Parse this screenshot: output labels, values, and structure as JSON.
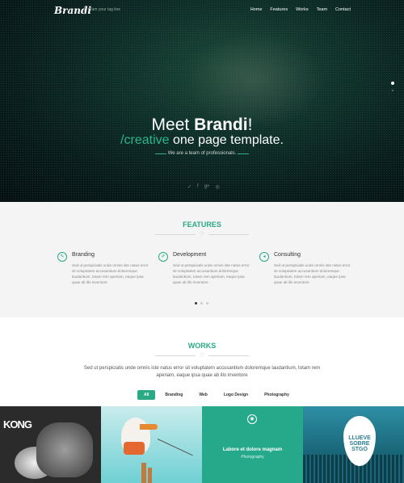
{
  "nav": {
    "logo": "Brandi",
    "tagline": "Tam your tag line",
    "menu": [
      "Home",
      "Features",
      "Works",
      "Team",
      "Contact"
    ]
  },
  "hero": {
    "title_pre": "Meet ",
    "title_bold": "Brandi",
    "title_post": "!",
    "sub_accent": "/creative",
    "sub_rest": " one page template.",
    "desc": "We are a team of professionals.",
    "social_icons": [
      "twitter-icon",
      "facebook-icon",
      "google-plus-icon",
      "dribbble-icon"
    ]
  },
  "features": {
    "title": "FEATURES",
    "items": [
      {
        "icon": "pen-icon",
        "title": "Branding",
        "text": "Sed ut perspiciatis unde omnis iste natus error sit voluptatem accusantium doloremque laudantium, totam rem aperiam, eaque ipsa quae ab illo inventore"
      },
      {
        "icon": "brush-icon",
        "title": "Development",
        "text": "Sed ut perspiciatis unde omnis iste natus error sit voluptatem accusantium doloremque laudantium, totam rem aperiam, eaque ipsa quae ab illo inventore"
      },
      {
        "icon": "megaphone-icon",
        "title": "Consulting",
        "text": "Sed ut perspiciatis unde omnis iste natus error sit voluptatem accusantium doloremque laudantium, totam rem aperiam, eaque ipsa quae ab illo inventore"
      }
    ]
  },
  "works": {
    "title": "WORKS",
    "desc": "Sed ut perspiciatis unde omnis iste natus error sit voluptatem accusantium doloremque laudantium, totam rem aperiam, eaque ipsa quae ab illo inventore",
    "filters": [
      "All",
      "Branding",
      "Web",
      "Logo Design",
      "Photography"
    ],
    "active_filter": "All",
    "grid": {
      "tile1_text": "KONG",
      "tile3_title": "Labore et dolore magnam",
      "tile3_sub": "Photography",
      "tile4_text": "LLUEVE SOBRE STGO"
    }
  },
  "colors": {
    "accent": "#2aa985",
    "hero_bg": "#0a1d1d"
  }
}
